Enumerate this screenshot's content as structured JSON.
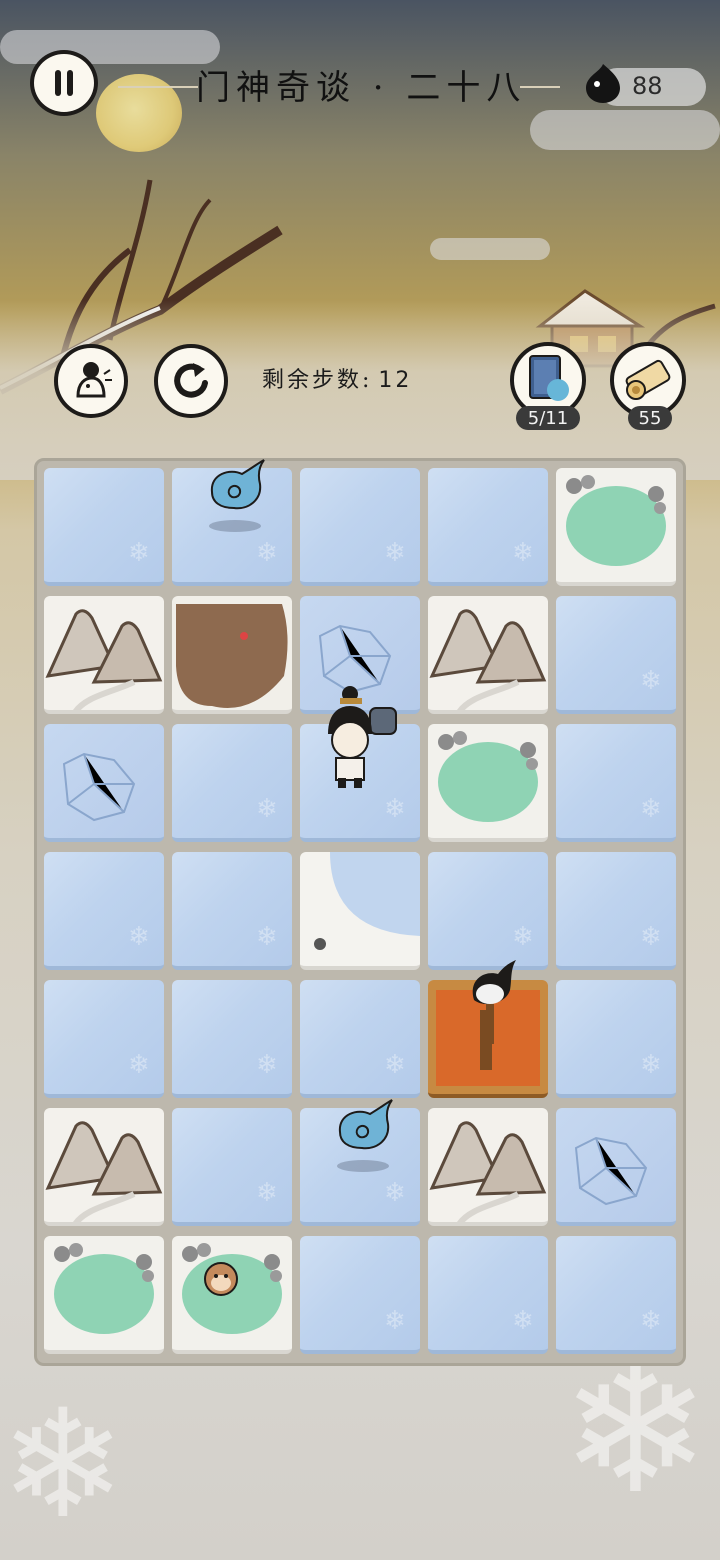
{
  "header": {
    "title": "门神奇谈 · 二十八",
    "currency_value": "88"
  },
  "controls": {
    "steps_label": "剩余步数:",
    "steps_value": "12"
  },
  "items": [
    {
      "name": "book",
      "count": "5/11"
    },
    {
      "name": "scroll",
      "count": "55"
    }
  ],
  "board": {
    "rows": 7,
    "cols": 5,
    "tiles": [
      [
        "ice",
        "ice",
        "ice",
        "ice",
        "pond"
      ],
      [
        "mountain",
        "mud",
        "cracked-ice",
        "mountain",
        "ice"
      ],
      [
        "cracked-ice",
        "ice",
        "ice",
        "pond",
        "ice"
      ],
      [
        "ice",
        "ice",
        "snow",
        "ice",
        "ice"
      ],
      [
        "ice",
        "ice",
        "ice",
        "shrine",
        "ice"
      ],
      [
        "mountain",
        "ice",
        "ice",
        "mountain",
        "cracked-ice"
      ],
      [
        "pond",
        "pond-monkey",
        "ice",
        "ice",
        "ice"
      ]
    ],
    "pieces": [
      {
        "type": "blue-spirit",
        "row": 0,
        "col": 1
      },
      {
        "type": "player-doorgod",
        "row": 2,
        "col": 2
      },
      {
        "type": "blue-spirit",
        "row": 5,
        "col": 2
      },
      {
        "type": "ink-ghost-torch",
        "row": 4,
        "col": 3
      },
      {
        "type": "monkey",
        "row": 6,
        "col": 1
      }
    ]
  },
  "colors": {
    "ice": "#c1d5ee",
    "pond": "#8fd3b4",
    "shrine": "#d9692a",
    "ink": "#1d1b19"
  }
}
